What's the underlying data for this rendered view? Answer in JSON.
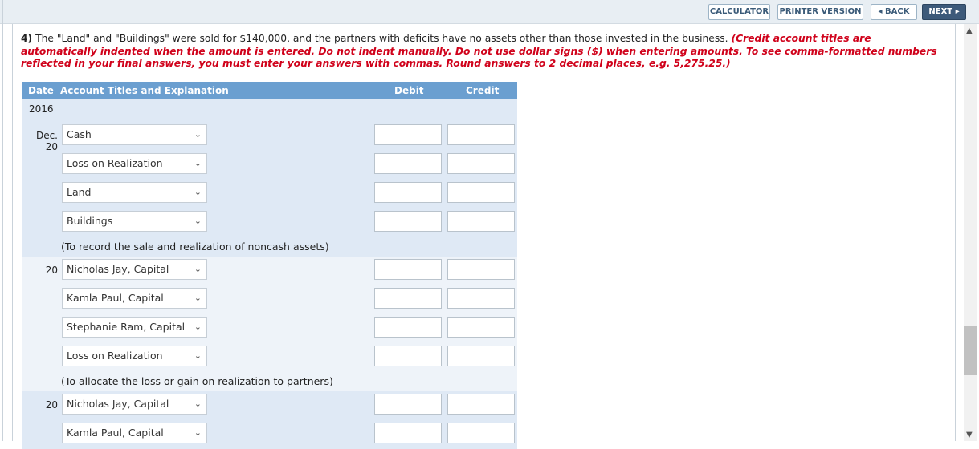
{
  "toolbar": {
    "calculator": "CALCULATOR",
    "printer": "PRINTER VERSION",
    "back": "◂ BACK",
    "next": "NEXT ▸"
  },
  "question": {
    "number": "4)",
    "text": " The \"Land\" and \"Buildings\" were sold for $140,000, and the partners with deficits have no assets other than those invested in the business. ",
    "instruction": "(Credit account titles are automatically indented when the amount is entered. Do not indent manually. Do not use dollar signs ($) when entering amounts. To see comma-formatted numbers reflected in your final answers, you must enter your answers with commas. Round answers to 2 decimal places, e.g. 5,275.25.)"
  },
  "table": {
    "headers": {
      "date": "Date",
      "account": "Account Titles and Explanation",
      "debit": "Debit",
      "credit": "Credit"
    },
    "year": "2016",
    "entries": [
      {
        "rows": [
          {
            "date": "Dec. 20",
            "account": "Cash"
          },
          {
            "date": "",
            "account": "Loss on Realization"
          },
          {
            "date": "",
            "account": "Land"
          },
          {
            "date": "",
            "account": "Buildings"
          }
        ],
        "memo": "(To record the sale and realization of noncash assets)"
      },
      {
        "rows": [
          {
            "date": "20",
            "account": "Nicholas Jay, Capital"
          },
          {
            "date": "",
            "account": "Kamla Paul, Capital"
          },
          {
            "date": "",
            "account": "Stephanie Ram, Capital"
          },
          {
            "date": "",
            "account": "Loss on Realization"
          }
        ],
        "memo": "(To allocate the loss or gain on realization to partners)"
      },
      {
        "rows": [
          {
            "date": "20",
            "account": "Nicholas Jay, Capital"
          },
          {
            "date": "",
            "account": "Kamla Paul, Capital"
          }
        ],
        "memo": ""
      }
    ]
  },
  "icons": {
    "dropdown": "chevron-down-icon",
    "scroll_up": "chevron-up-icon",
    "scroll_down": "chevron-down-icon"
  },
  "colors": {
    "header_blue": "#6b9fd0",
    "instruction_red": "#d0021b",
    "next_button": "#3d5a7a"
  }
}
